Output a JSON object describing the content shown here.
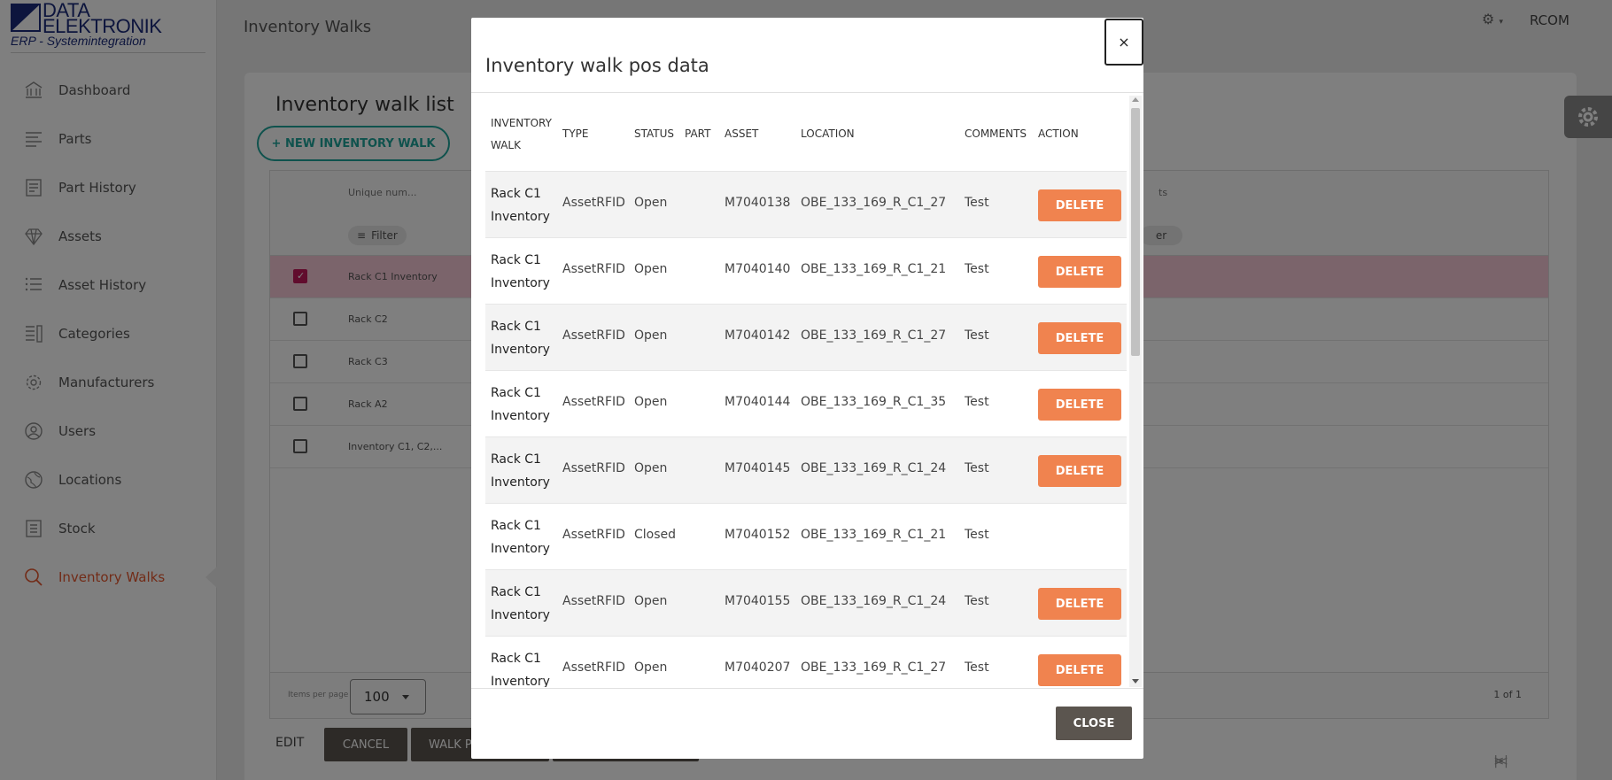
{
  "logo": {
    "line1": "DATA",
    "line2": "ELEKTRONIK",
    "line3": "ERP - Systemintegration"
  },
  "sidebar": {
    "items": [
      {
        "label": "Dashboard",
        "icon": "bank-icon"
      },
      {
        "label": "Parts",
        "icon": "lines-icon"
      },
      {
        "label": "Part History",
        "icon": "document-list-icon"
      },
      {
        "label": "Assets",
        "icon": "diamond-icon"
      },
      {
        "label": "Asset History",
        "icon": "list-icon"
      },
      {
        "label": "Categories",
        "icon": "category-icon"
      },
      {
        "label": "Manufacturers",
        "icon": "gear-icon"
      },
      {
        "label": "Users",
        "icon": "user-icon"
      },
      {
        "label": "Locations",
        "icon": "globe-icon"
      },
      {
        "label": "Stock",
        "icon": "stock-icon"
      },
      {
        "label": "Inventory Walks",
        "icon": "search-icon"
      }
    ]
  },
  "header": {
    "title": "Inventory Walks",
    "user": "RCOM"
  },
  "list": {
    "title": "Inventory walk list",
    "new_button": "+ NEW INVENTORY WALK",
    "columns": {
      "unique": "Unique num...",
      "right": "ts"
    },
    "filter_label": "Filter",
    "filter_label2": "er",
    "rows": [
      "Rack C1 Inventory",
      "Rack C2",
      "Rack C3",
      "Rack A2",
      "Inventory C1, C2,..."
    ],
    "items_per_page_label": "Items per page",
    "items_per_page": "100",
    "page_info": "1 of 1",
    "pager": {
      "first": "|<",
      "prev": "<",
      "next": ">",
      "last": ">|"
    }
  },
  "actions": {
    "edit": "EDIT",
    "cancel": "CANCEL",
    "walk": "WALK P"
  },
  "modal": {
    "title": "Inventory walk pos data",
    "close_x": "×",
    "close_button": "CLOSE",
    "columns": {
      "walk_1": "INVENTORY",
      "walk_2": "WALK",
      "type": "TYPE",
      "status": "STATUS",
      "part": "PART",
      "asset": "ASSET",
      "location": "LOCATION",
      "comments": "COMMENTS",
      "action": "ACTION"
    },
    "delete_label": "DELETE",
    "rows": [
      {
        "walk_1": "Rack C1",
        "walk_2": "Inventory",
        "type": "AssetRFID",
        "status": "Open",
        "part": "",
        "asset": "M7040138",
        "location": "OBE_133_169_R_C1_27",
        "comments": "Test"
      },
      {
        "walk_1": "Rack C1",
        "walk_2": "Inventory",
        "type": "AssetRFID",
        "status": "Open",
        "part": "",
        "asset": "M7040140",
        "location": "OBE_133_169_R_C1_21",
        "comments": "Test"
      },
      {
        "walk_1": "Rack C1",
        "walk_2": "Inventory",
        "type": "AssetRFID",
        "status": "Open",
        "part": "",
        "asset": "M7040142",
        "location": "OBE_133_169_R_C1_27",
        "comments": "Test"
      },
      {
        "walk_1": "Rack C1",
        "walk_2": "Inventory",
        "type": "AssetRFID",
        "status": "Open",
        "part": "",
        "asset": "M7040144",
        "location": "OBE_133_169_R_C1_35",
        "comments": "Test"
      },
      {
        "walk_1": "Rack C1",
        "walk_2": "Inventory",
        "type": "AssetRFID",
        "status": "Open",
        "part": "",
        "asset": "M7040145",
        "location": "OBE_133_169_R_C1_24",
        "comments": "Test"
      },
      {
        "walk_1": "Rack C1",
        "walk_2": "Inventory",
        "type": "AssetRFID",
        "status": "Closed",
        "part": "",
        "asset": "M7040152",
        "location": "OBE_133_169_R_C1_21",
        "comments": "Test"
      },
      {
        "walk_1": "Rack C1",
        "walk_2": "Inventory",
        "type": "AssetRFID",
        "status": "Open",
        "part": "",
        "asset": "M7040155",
        "location": "OBE_133_169_R_C1_24",
        "comments": "Test"
      },
      {
        "walk_1": "Rack C1",
        "walk_2": "Inventory",
        "type": "AssetRFID",
        "status": "Open",
        "part": "",
        "asset": "M7040207",
        "location": "OBE_133_169_R_C1_27",
        "comments": "Test"
      }
    ]
  },
  "colors": {
    "accent": "#e4572e",
    "teal": "#1fa49a",
    "delete": "#f0834f",
    "dark_button": "#5b554f",
    "selected_row": "#f7c9d7"
  }
}
